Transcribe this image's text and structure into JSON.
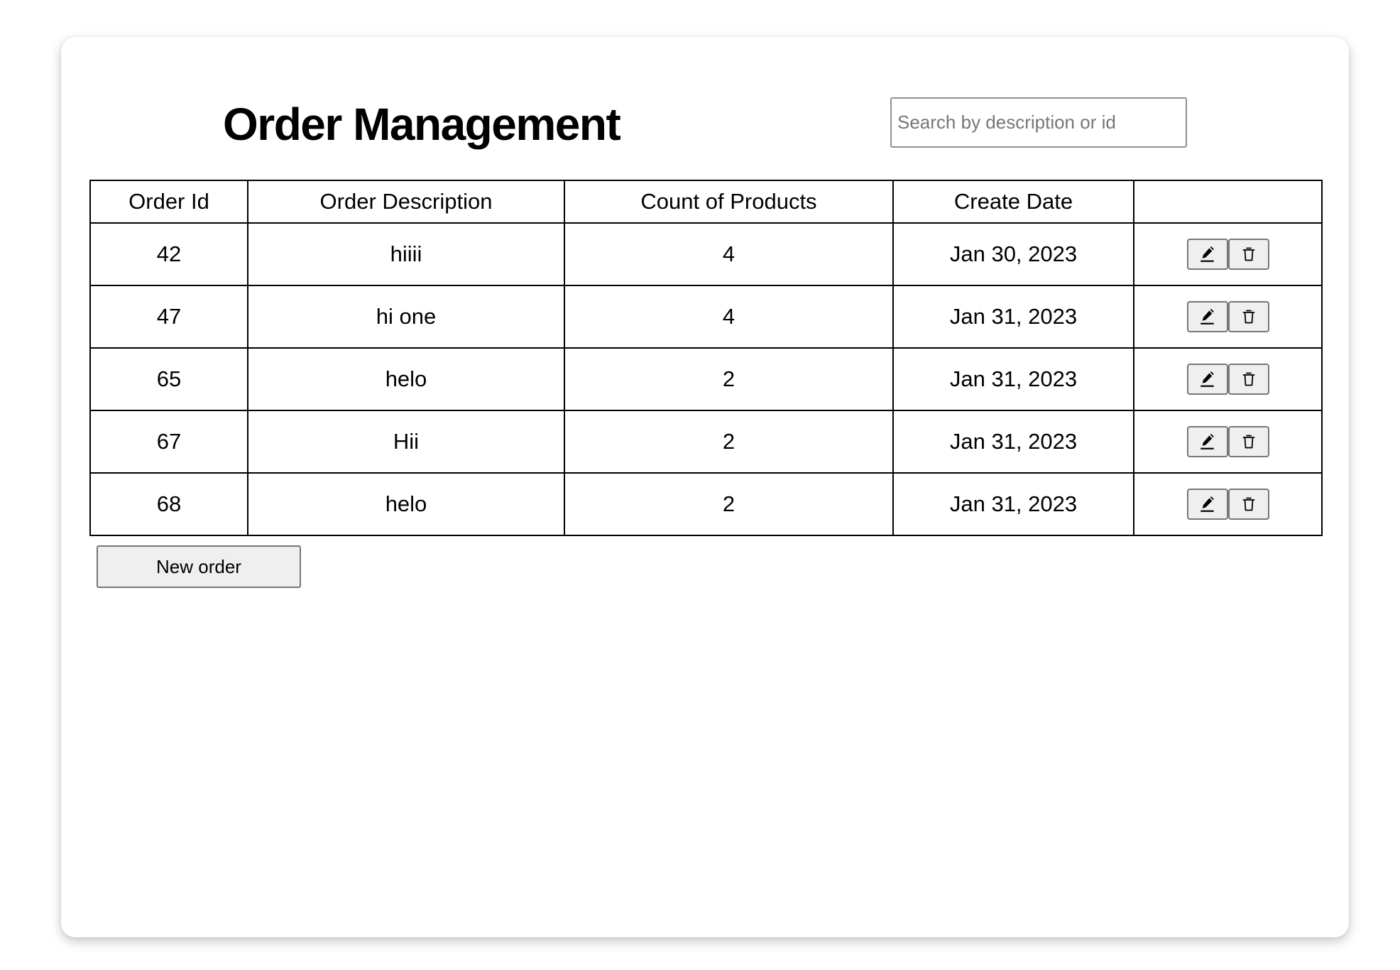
{
  "page": {
    "title": "Order Management"
  },
  "search": {
    "placeholder": "Search by description or id",
    "value": ""
  },
  "table": {
    "columns": [
      "Order Id",
      "Order Description",
      "Count of Products",
      "Create Date",
      ""
    ],
    "rows": [
      {
        "id": "42",
        "description": "hiiii",
        "count": "4",
        "date": "Jan 30, 2023"
      },
      {
        "id": "47",
        "description": "hi one",
        "count": "4",
        "date": "Jan 31, 2023"
      },
      {
        "id": "65",
        "description": "helo",
        "count": "2",
        "date": "Jan 31, 2023"
      },
      {
        "id": "67",
        "description": "Hii",
        "count": "2",
        "date": "Jan 31, 2023"
      },
      {
        "id": "68",
        "description": "helo",
        "count": "2",
        "date": "Jan 31, 2023"
      }
    ],
    "row_actions": {
      "edit_icon": "pencil-icon",
      "delete_icon": "trash-icon"
    }
  },
  "actions": {
    "new_order_label": "New order"
  }
}
